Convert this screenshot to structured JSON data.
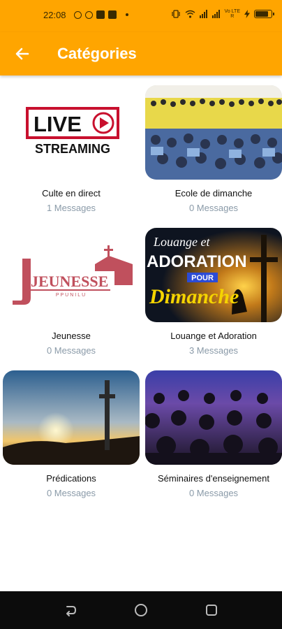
{
  "status_bar": {
    "time": "22:08",
    "left_icons": [
      "facebook-icon",
      "facebook-icon",
      "mail-icon",
      "mail-icon"
    ],
    "right_icons": [
      "vibrate-icon",
      "wifi-icon",
      "signal-icon",
      "signal-icon",
      "lte-icon",
      "charging-icon",
      "battery-icon"
    ],
    "lte_label_top": "Vo LTE",
    "lte_label_bottom": "R",
    "battery_level": 0.8
  },
  "app_bar": {
    "title": "Catégories",
    "background": "#FFA500"
  },
  "categories": [
    {
      "title": "Culte en direct",
      "count": "1 Messages",
      "image": "live-streaming-logo",
      "image_text": {
        "line1": "LIVE",
        "line2": "STREAMING"
      }
    },
    {
      "title": "Ecole de dimanche",
      "count": "0 Messages",
      "image": "church-choir-photo"
    },
    {
      "title": "Jeunesse",
      "count": "0 Messages",
      "image": "jeunesse-logo",
      "image_text": {
        "line1": "JEUNESSE",
        "line2": "PPUNILU"
      }
    },
    {
      "title": "Louange et Adoration",
      "count": "3 Messages",
      "image": "louange-adoration-banner",
      "image_text": {
        "line1": "Louange et",
        "line2": "ADORATION",
        "line3": "POUR",
        "line4": "Dimanche"
      }
    },
    {
      "title": "Prédications",
      "count": "0 Messages",
      "image": "sunset-cross-photo"
    },
    {
      "title": "Séminaires d'enseignement",
      "count": "0 Messages",
      "image": "seminar-audience-photo"
    }
  ],
  "nav_bar": {
    "buttons": [
      "back-nav-icon",
      "home-nav-icon",
      "recents-nav-icon"
    ]
  }
}
